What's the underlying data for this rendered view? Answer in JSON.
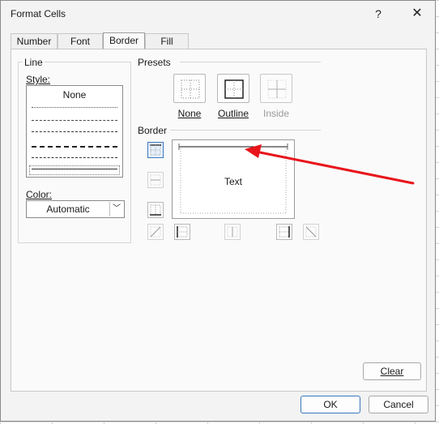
{
  "dialog": {
    "title": "Format Cells",
    "help_glyph": "?",
    "close_glyph": "✕"
  },
  "tabs": [
    {
      "label": "Number"
    },
    {
      "label": "Font"
    },
    {
      "label": "Border",
      "active": true
    },
    {
      "label": "Fill"
    }
  ],
  "line": {
    "section": "Line",
    "style_label": "Style:",
    "style_none": "None",
    "color_label": "Color:",
    "color_value": "Automatic"
  },
  "presets": {
    "section": "Presets",
    "items": [
      {
        "label": "None"
      },
      {
        "label": "Outline"
      },
      {
        "label": "Inside",
        "disabled": true
      }
    ]
  },
  "border": {
    "section": "Border",
    "preview_text": "Text"
  },
  "buttons": {
    "clear": "Clear",
    "ok": "OK",
    "cancel": "Cancel"
  },
  "colors": {
    "accent": "#3a78c0",
    "arrow": "#e8151b"
  }
}
